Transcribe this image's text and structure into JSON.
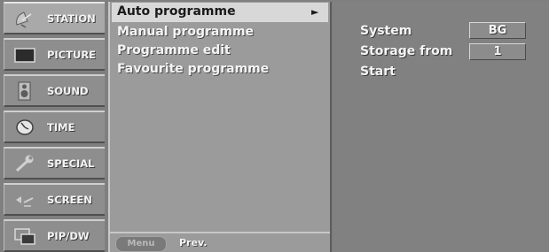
{
  "categories": [
    {
      "label": "STATION",
      "icon": "satellite-dish-icon"
    },
    {
      "label": "PICTURE",
      "icon": "tv-screen-icon"
    },
    {
      "label": "SOUND",
      "icon": "speaker-icon"
    },
    {
      "label": "TIME",
      "icon": "clock-icon"
    },
    {
      "label": "SPECIAL",
      "icon": "wrench-icon"
    },
    {
      "label": "SCREEN",
      "icon": "screen-adjust-icon"
    },
    {
      "label": "PIP/DW",
      "icon": "pip-icon"
    }
  ],
  "active_category": "STATION",
  "menu": {
    "items": [
      {
        "label": "Auto programme",
        "selected": true,
        "has_submenu": true
      },
      {
        "label": "Manual programme"
      },
      {
        "label": "Programme edit"
      },
      {
        "label": "Favourite programme"
      }
    ],
    "arrow_glyph": "►",
    "footer": {
      "key_label": "Menu",
      "action_label": "Prev."
    }
  },
  "settings": {
    "rows": [
      {
        "label": "System",
        "value": "BG"
      },
      {
        "label": "Storage from",
        "value": "1"
      },
      {
        "label": "Start"
      }
    ]
  },
  "colors": {
    "background": "#7f7f7f",
    "highlight": "#d8d8d8",
    "text": "#f4f4f4"
  }
}
